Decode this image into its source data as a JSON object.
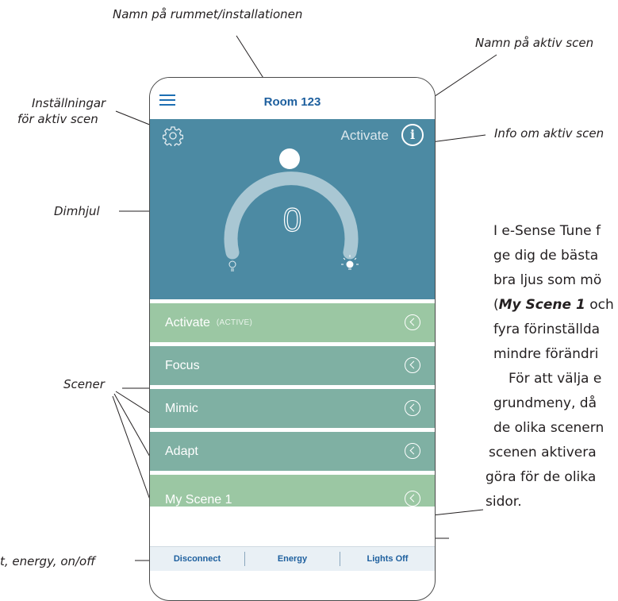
{
  "annotations": {
    "room_name": "Namn på rummet/installationen",
    "active_scene_name": "Namn på aktiv scen",
    "settings": [
      "Inställningar",
      "för aktiv scen"
    ],
    "info": "Info om aktiv scen",
    "dim_wheel": "Dimhjul",
    "scenes": "Scener",
    "bottom": "t, energy, on/off"
  },
  "app": {
    "title": "Room 123",
    "active_scene": "Activate",
    "info_symbol": "i",
    "dim_value": "0"
  },
  "scenes": [
    {
      "label": "Activate",
      "tag": "(ACTIVE)"
    },
    {
      "label": "Focus",
      "tag": ""
    },
    {
      "label": "Mimic",
      "tag": ""
    },
    {
      "label": "Adapt",
      "tag": ""
    },
    {
      "label": "My Scene 1",
      "tag": ""
    }
  ],
  "bottom_bar": {
    "disconnect": "Disconnect",
    "energy": "Energy",
    "lights_off": "Lights Off"
  },
  "body_text": {
    "l1": "I e-Sense Tune f",
    "l2": "ge dig de bästa",
    "l3": "bra ljus som mö",
    "l4_open": "(",
    "l4_bold": "My Scene 1",
    "l4_rest": " och",
    "l5": "fyra förinställda",
    "l6": "mindre förändri",
    "l7": "För att välja e",
    "l8": "grundmeny, då",
    "l9": "de olika scenern",
    "l10": "scenen aktivera",
    "l11": "göra för de olika",
    "l12": "sidor."
  },
  "colors": {
    "hero": "#4c8aa3",
    "active_scene": "#9bc7a3",
    "scene": "#7fb0a3",
    "accent": "#1d5f9e"
  }
}
